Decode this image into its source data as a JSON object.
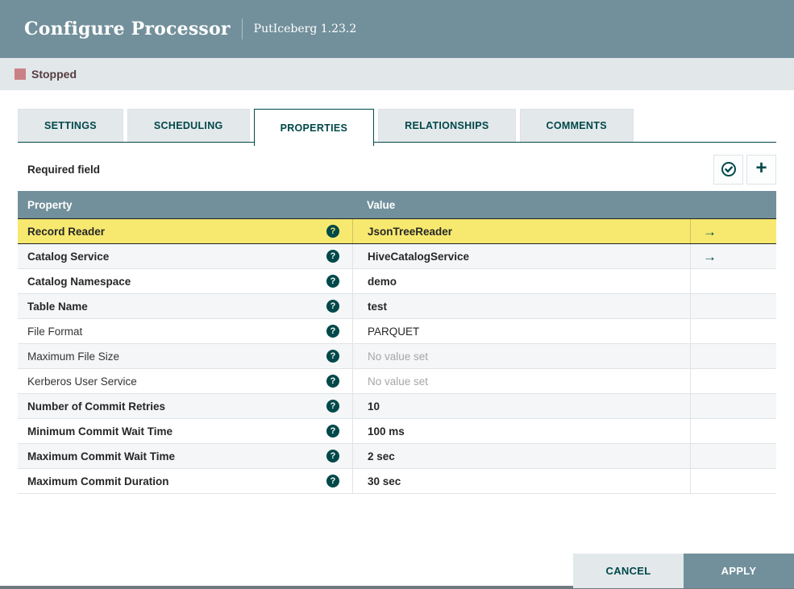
{
  "header": {
    "title": "Configure Processor",
    "subtitle": "PutIceberg 1.23.2"
  },
  "status": {
    "label": "Stopped",
    "color": "#ca8185"
  },
  "tabs": [
    {
      "label": "SETTINGS",
      "active": false
    },
    {
      "label": "SCHEDULING",
      "active": false
    },
    {
      "label": "PROPERTIES",
      "active": true
    },
    {
      "label": "RELATIONSHIPS",
      "active": false
    },
    {
      "label": "COMMENTS",
      "active": false
    }
  ],
  "toolbar": {
    "required_label": "Required field",
    "icons": [
      "verify-properties-icon",
      "add-property-icon"
    ]
  },
  "table": {
    "columns": [
      "Property",
      "Value"
    ],
    "rows": [
      {
        "property": "Record Reader",
        "value": "JsonTreeReader",
        "required": true,
        "value_set": true,
        "selected": true,
        "arrow": true
      },
      {
        "property": "Catalog Service",
        "value": "HiveCatalogService",
        "required": true,
        "value_set": true,
        "selected": false,
        "arrow": true
      },
      {
        "property": "Catalog Namespace",
        "value": "demo",
        "required": true,
        "value_set": true,
        "selected": false,
        "arrow": false
      },
      {
        "property": "Table Name",
        "value": "test",
        "required": true,
        "value_set": true,
        "selected": false,
        "arrow": false
      },
      {
        "property": "File Format",
        "value": "PARQUET",
        "required": false,
        "value_set": true,
        "selected": false,
        "arrow": false
      },
      {
        "property": "Maximum File Size",
        "value": "No value set",
        "required": false,
        "value_set": false,
        "selected": false,
        "arrow": false
      },
      {
        "property": "Kerberos User Service",
        "value": "No value set",
        "required": false,
        "value_set": false,
        "selected": false,
        "arrow": false
      },
      {
        "property": "Number of Commit Retries",
        "value": "10",
        "required": true,
        "value_set": true,
        "selected": false,
        "arrow": false
      },
      {
        "property": "Minimum Commit Wait Time",
        "value": "100 ms",
        "required": true,
        "value_set": true,
        "selected": false,
        "arrow": false
      },
      {
        "property": "Maximum Commit Wait Time",
        "value": "2 sec",
        "required": true,
        "value_set": true,
        "selected": false,
        "arrow": false
      },
      {
        "property": "Maximum Commit Duration",
        "value": "30 sec",
        "required": true,
        "value_set": true,
        "selected": false,
        "arrow": false
      }
    ]
  },
  "footer": {
    "cancel_label": "CANCEL",
    "apply_label": "APPLY"
  },
  "colors": {
    "header_bg": "#72909b",
    "teal": "#004849",
    "selected_row": "#f7e96f",
    "status_bar_bg": "#e2e7ea",
    "alt_row": "#f4f6f7"
  }
}
